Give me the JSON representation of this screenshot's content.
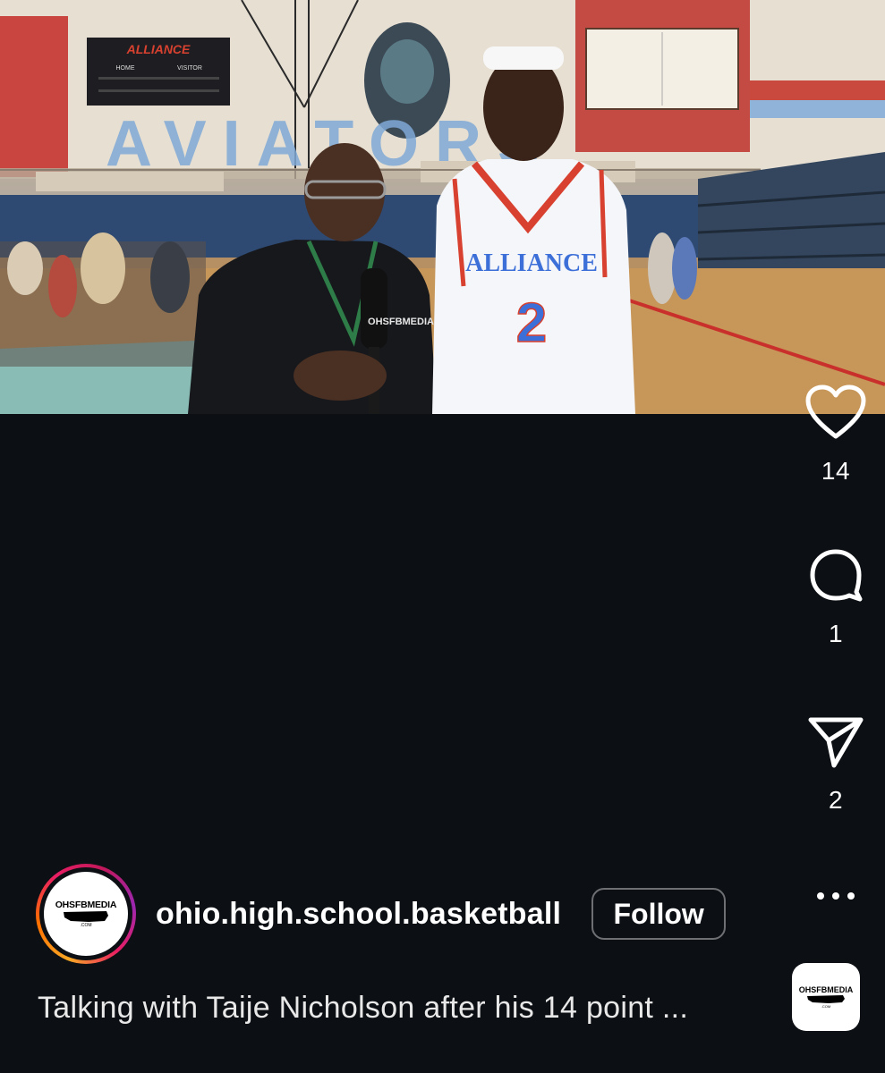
{
  "video": {
    "scoreboard_text": "ALLIANCE",
    "scoreboard_home": "HOME",
    "scoreboard_visitor": "VISITOR",
    "wall_text": "AVIATORS",
    "jersey_text": "ALLIANCE",
    "jersey_number": "2",
    "mic_text": "OHSFBMEDIA"
  },
  "actions": {
    "like_count": "14",
    "comment_count": "1",
    "share_count": "2"
  },
  "author": {
    "username": "ohio.high.school.basketball",
    "follow_label": "Follow",
    "avatar_brand": "OHSFBMEDIA",
    "avatar_sub": ".COM"
  },
  "caption": {
    "text": "Talking with Taije Nicholson after his 14 point ..."
  },
  "audio": {
    "brand": "OHSFBMEDIA",
    "sub": ".COM"
  },
  "colors": {
    "background": "#0c0f13",
    "follow_border": "#6d6f73",
    "jersey_blue": "#3d6fd8",
    "jersey_red": "#d8412f"
  }
}
